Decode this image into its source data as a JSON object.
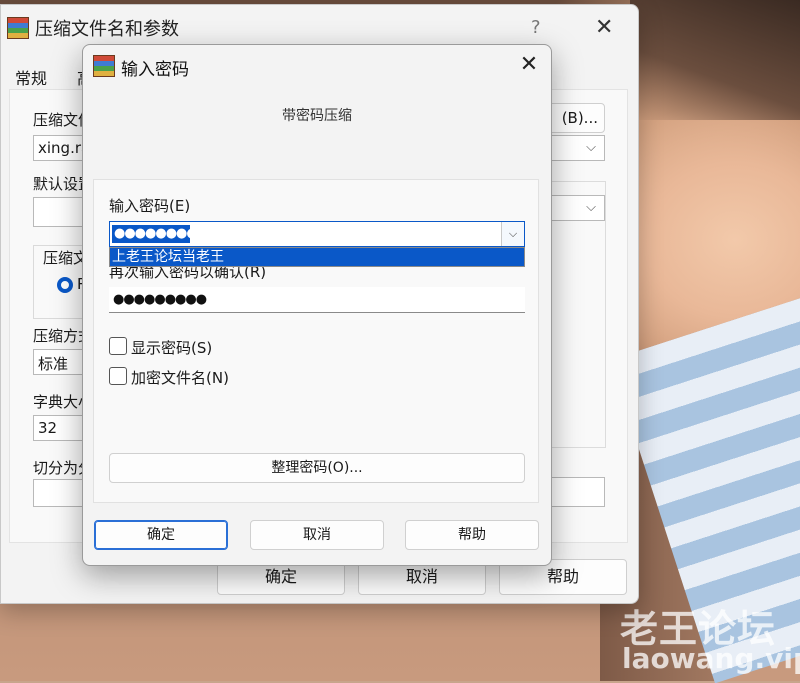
{
  "background": {
    "watermark": "老王论坛",
    "watermark_domain": "laowang.vip"
  },
  "back_window": {
    "title": "压缩文件名和参数",
    "help_glyph": "?",
    "close_glyph": "✕",
    "tabs": [
      "常规",
      "高"
    ],
    "archive_name_label": "压缩文件",
    "archive_name_value": "xing.ra",
    "browse_label": "(B)...",
    "default_profile_label": "默认设置",
    "format_label": "压缩文",
    "format_radio_text": "R",
    "method_label": "压缩方式",
    "method_value": "标准",
    "dictionary_label": "字典大小",
    "dictionary_value": "32",
    "split_label": "切分为分",
    "dropdown_glyph": "⌵",
    "buttons": {
      "ok": "确定",
      "cancel": "取消",
      "help": "帮助"
    }
  },
  "dialog": {
    "title": "输入密码",
    "close_glyph": "✕",
    "profile_text": "带密码压缩",
    "password_label": "输入密码(E)",
    "password_value": "●●●●●●●●●",
    "dropdown_glyph": "⌵",
    "dropdown_options": [
      "上老王论坛当老王"
    ],
    "confirm_label": "再次输入密码以确认(R)",
    "confirm_value": "●●●●●●●●●",
    "show_password_label": "显示密码(S)",
    "encrypt_names_label": "加密文件名(N)",
    "organize_button": "整理密码(O)...",
    "buttons": {
      "ok": "确定",
      "cancel": "取消",
      "help": "帮助"
    }
  }
}
